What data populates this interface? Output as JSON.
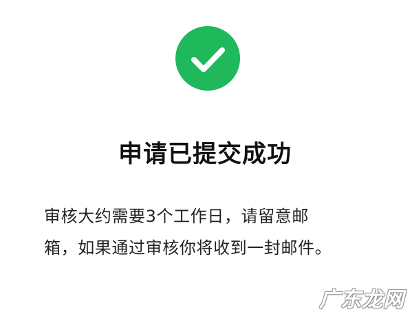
{
  "status": {
    "icon": "check-circle-icon",
    "icon_color": "#1fb85a"
  },
  "title": "申请已提交成功",
  "description": {
    "line1": "审核大约需要3个工作日，请留意邮",
    "line2": "箱，如果通过审核你将收到一封邮件。"
  },
  "watermark": "广东龙网"
}
